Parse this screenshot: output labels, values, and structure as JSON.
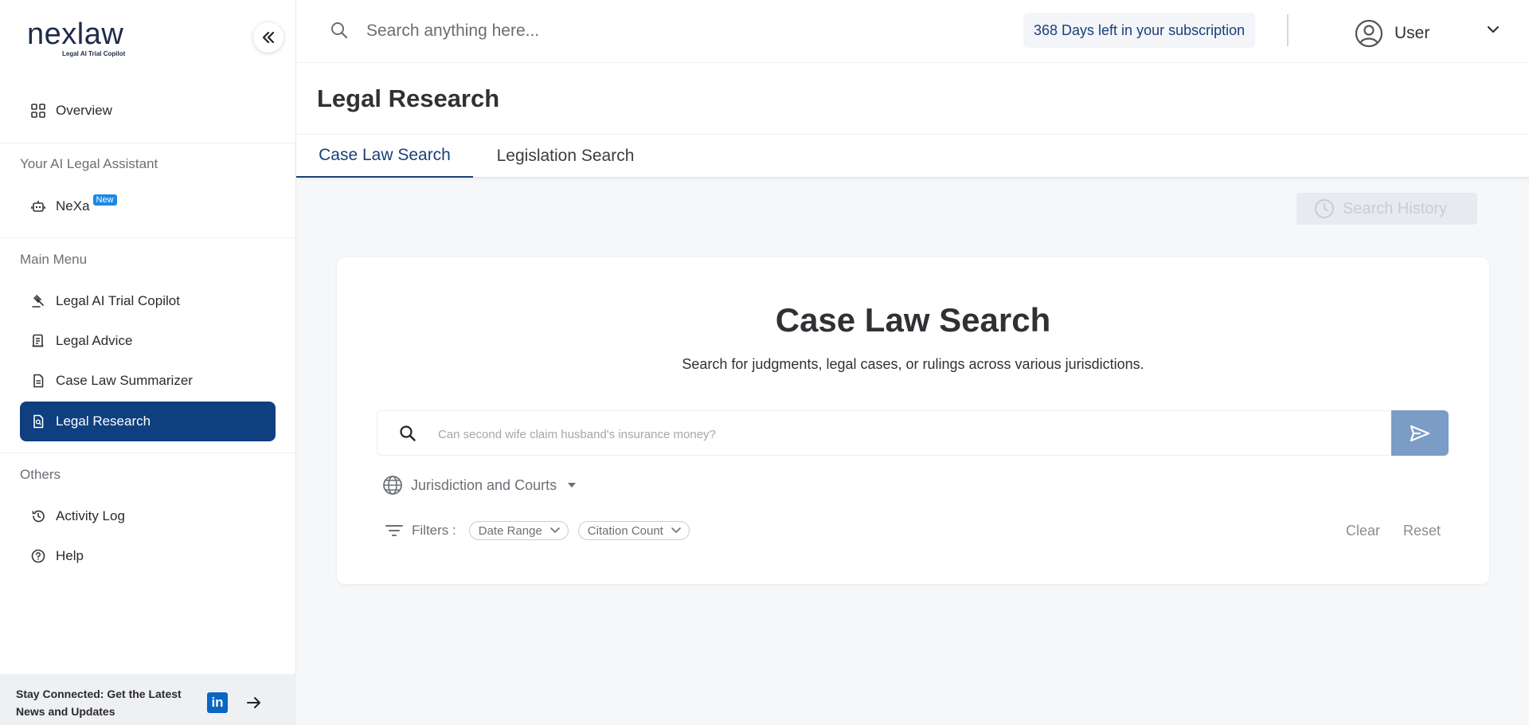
{
  "logo": {
    "word": "nexlaw",
    "tagline": "Legal AI Trial Copilot"
  },
  "sidebar": {
    "overview": "Overview",
    "section_assistant": "Your AI Legal Assistant",
    "nexa": "NeXa",
    "nexa_badge": "New",
    "section_main": "Main Menu",
    "main_items": [
      {
        "label": "Legal AI Trial Copilot",
        "icon": "gavel-icon"
      },
      {
        "label": "Legal Advice",
        "icon": "scroll-icon"
      },
      {
        "label": "Case Law Summarizer",
        "icon": "document-icon"
      },
      {
        "label": "Legal Research",
        "icon": "document-search-icon",
        "active": true
      }
    ],
    "section_others": "Others",
    "other_items": [
      {
        "label": "Activity Log",
        "icon": "history-icon"
      },
      {
        "label": "Help",
        "icon": "help-icon"
      }
    ],
    "footer_text": "Stay Connected: Get the Latest News and Updates"
  },
  "topbar": {
    "search_placeholder": "Search anything here...",
    "subscription": "368 Days left in your subscription",
    "user_name": "User"
  },
  "page": {
    "title": "Legal Research",
    "tabs": [
      {
        "label": "Case Law Search",
        "active": true
      },
      {
        "label": "Legislation Search",
        "active": false
      }
    ],
    "search_history": "Search History"
  },
  "card": {
    "title": "Case Law Search",
    "subtitle": "Search for judgments, legal cases, or rulings across various jurisdictions.",
    "search_placeholder": "Can second wife claim husband's insurance money?",
    "jurisdiction": "Jurisdiction and Courts",
    "filters_label": "Filters :",
    "filter_chips": [
      "Date Range",
      "Citation Count"
    ],
    "clear": "Clear",
    "reset": "Reset"
  },
  "colors": {
    "primary": "#0f3f7f",
    "send_button": "#7a9cc6",
    "linkedin": "#0a66c2",
    "badge": "#1e88e5"
  }
}
